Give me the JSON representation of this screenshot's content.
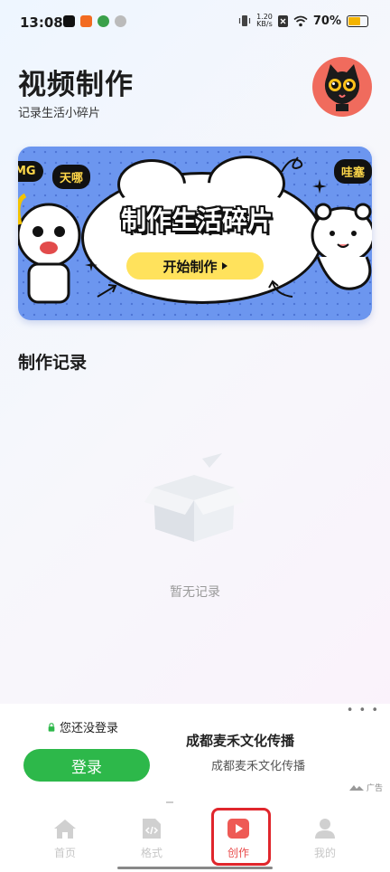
{
  "status_bar": {
    "time": "13:08",
    "net_speed_value": "1.20",
    "net_speed_unit": "KB/s",
    "battery": "70%",
    "battery_level": 0.7
  },
  "header": {
    "title": "视频制作",
    "subtitle": "记录生活小碎片"
  },
  "banner": {
    "title": "制作生活碎片",
    "start_label": "开始制作",
    "bubble_left": "天哪",
    "bubble_right": "哇塞",
    "bubble_edge": "MG"
  },
  "records": {
    "section_title": "制作记录",
    "empty_text": "暂无记录"
  },
  "ad": {
    "login_hint": "您还没登录",
    "login_button": "登录",
    "title": "成都麦禾文化传播",
    "subtitle": "成都麦禾文化传播",
    "ad_label": "广告",
    "menu_dots": "• • •"
  },
  "tabs": [
    {
      "label": "首页",
      "icon": "home-icon"
    },
    {
      "label": "格式",
      "icon": "code-file-icon"
    },
    {
      "label": "创作",
      "icon": "play-icon",
      "active": true
    },
    {
      "label": "我的",
      "icon": "user-icon"
    }
  ],
  "colors": {
    "accent_red": "#e94b4b",
    "login_green": "#2db84a",
    "banner_blue": "#6c96ef",
    "highlight_red": "#e0262c"
  }
}
